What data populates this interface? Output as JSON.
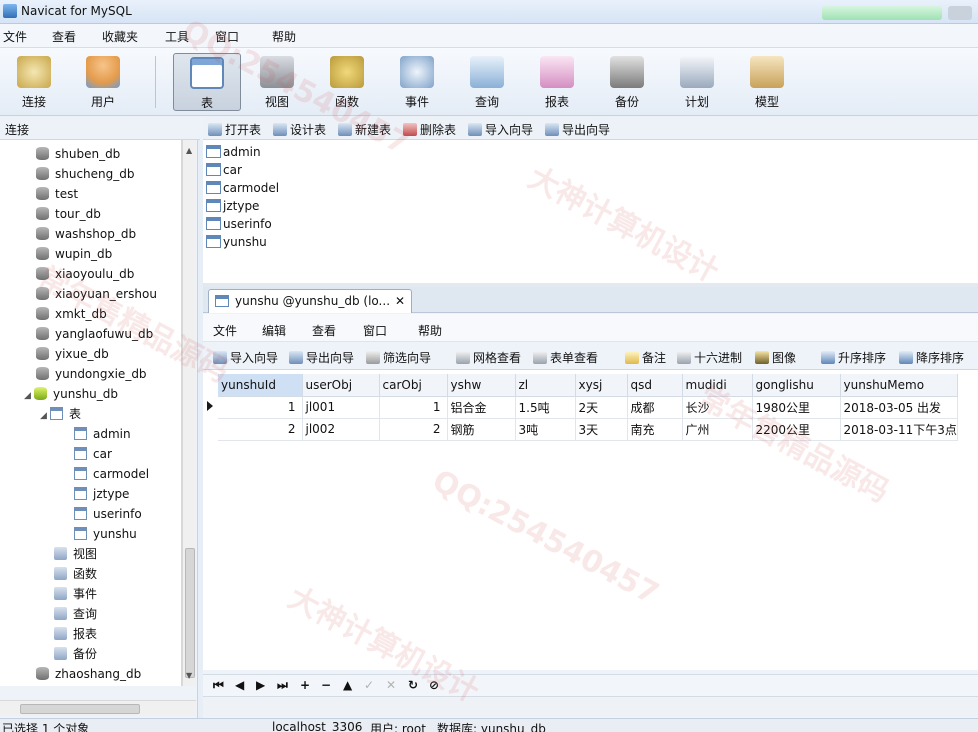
{
  "window": {
    "title": "Navicat for MySQL"
  },
  "menu": [
    "文件",
    "查看",
    "收藏夹",
    "工具",
    "窗口",
    "帮助"
  ],
  "toolbar": {
    "items": [
      {
        "label": "连接",
        "icon": "connection-icon",
        "color": "#c9a64a"
      },
      {
        "label": "用户",
        "icon": "user-icon",
        "color": "#e49b4c"
      },
      {
        "label": "表",
        "icon": "table-icon",
        "color": "#7ea6d6",
        "active": true
      },
      {
        "label": "视图",
        "icon": "view-icon",
        "color": "#8b8f96"
      },
      {
        "label": "函数",
        "icon": "function-icon",
        "color": "#b99a3a"
      },
      {
        "label": "事件",
        "icon": "event-icon",
        "color": "#7fa2c9"
      },
      {
        "label": "查询",
        "icon": "query-icon",
        "color": "#8ab0d6"
      },
      {
        "label": "报表",
        "icon": "report-icon",
        "color": "#d48ec2"
      },
      {
        "label": "备份",
        "icon": "backup-icon",
        "color": "#7b7b7b"
      },
      {
        "label": "计划",
        "icon": "schedule-icon",
        "color": "#9aa9bd"
      },
      {
        "label": "模型",
        "icon": "model-icon",
        "color": "#c8a25a"
      }
    ]
  },
  "left_panel": {
    "header": "连接",
    "tree": [
      {
        "label": "shuben_db",
        "kind": "db"
      },
      {
        "label": "shucheng_db",
        "kind": "db"
      },
      {
        "label": "test",
        "kind": "db"
      },
      {
        "label": "tour_db",
        "kind": "db"
      },
      {
        "label": "washshop_db",
        "kind": "db"
      },
      {
        "label": "wupin_db",
        "kind": "db"
      },
      {
        "label": "xiaoyoulu_db",
        "kind": "db"
      },
      {
        "label": "xiaoyuan_ershou",
        "kind": "db"
      },
      {
        "label": "xmkt_db",
        "kind": "db"
      },
      {
        "label": "yanglaofuwu_db",
        "kind": "db"
      },
      {
        "label": "yixue_db",
        "kind": "db"
      },
      {
        "label": "yundongxie_db",
        "kind": "db"
      },
      {
        "label": "yunshu_db",
        "kind": "db-open"
      },
      {
        "label": "表",
        "kind": "tables-folder"
      },
      {
        "label": "admin",
        "kind": "table"
      },
      {
        "label": "car",
        "kind": "table"
      },
      {
        "label": "carmodel",
        "kind": "table"
      },
      {
        "label": "jztype",
        "kind": "table"
      },
      {
        "label": "userinfo",
        "kind": "table"
      },
      {
        "label": "yunshu",
        "kind": "table"
      },
      {
        "label": "视图",
        "kind": "folder"
      },
      {
        "label": "函数",
        "kind": "folder"
      },
      {
        "label": "事件",
        "kind": "folder"
      },
      {
        "label": "查询",
        "kind": "folder"
      },
      {
        "label": "报表",
        "kind": "folder"
      },
      {
        "label": "备份",
        "kind": "folder"
      },
      {
        "label": "zhaoshang_db",
        "kind": "db"
      }
    ]
  },
  "object_toolbar": [
    {
      "label": "打开表",
      "icon": "open-table-icon"
    },
    {
      "label": "设计表",
      "icon": "design-table-icon"
    },
    {
      "label": "新建表",
      "icon": "new-table-icon"
    },
    {
      "label": "删除表",
      "icon": "delete-table-icon"
    },
    {
      "label": "导入向导",
      "icon": "import-wizard-icon"
    },
    {
      "label": "导出向导",
      "icon": "export-wizard-icon"
    }
  ],
  "objects": [
    "admin",
    "car",
    "carmodel",
    "jztype",
    "userinfo",
    "yunshu"
  ],
  "tab": {
    "label": "yunshu @yunshu_db (lo...",
    "close": "✕"
  },
  "sub_menu": [
    "文件",
    "编辑",
    "查看",
    "窗口",
    "帮助"
  ],
  "grid_toolbar": [
    {
      "label": "导入向导",
      "icon": "import-icon"
    },
    {
      "label": "导出向导",
      "icon": "export-icon"
    },
    {
      "label": "筛选向导",
      "icon": "filter-icon"
    },
    {
      "label": "网格查看",
      "icon": "grid-view-icon"
    },
    {
      "label": "表单查看",
      "icon": "form-view-icon"
    },
    {
      "label": "备注",
      "icon": "memo-icon"
    },
    {
      "label": "十六进制",
      "icon": "hex-icon"
    },
    {
      "label": "图像",
      "icon": "image-icon"
    },
    {
      "label": "升序排序",
      "icon": "sort-asc-icon"
    },
    {
      "label": "降序排序",
      "icon": "sort-desc-icon"
    }
  ],
  "table": {
    "columns": [
      "yunshuId",
      "userObj",
      "carObj",
      "yshw",
      "zl",
      "xysj",
      "qsd",
      "mudidi",
      "gonglishu",
      "yunshuMemo"
    ],
    "rows": [
      [
        "1",
        "jl001",
        "1",
        "铝合金",
        "1.5吨",
        "2天",
        "成都",
        "长沙",
        "1980公里",
        "2018-03-05 出发"
      ],
      [
        "2",
        "jl002",
        "2",
        "钢筋",
        "3吨",
        "3天",
        "南充",
        "广州",
        "2200公里",
        "2018-03-11下午3点"
      ]
    ]
  },
  "nav_bar": [
    "⏮",
    "◀",
    "▶",
    "⏭",
    "+",
    "−",
    "▲",
    "✓",
    "✕",
    "↻",
    "⊘"
  ],
  "status": {
    "selection": "已选择 1 个对象",
    "connection": "localhost_3306",
    "user": "用户: root",
    "database": "数据库: yunshu_db"
  },
  "watermark": [
    "QQ:254540457",
    "大神计算机设计",
    "常年售精品源码"
  ]
}
